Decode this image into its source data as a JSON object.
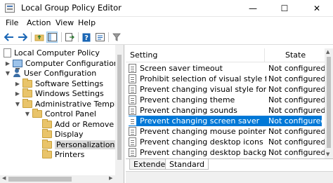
{
  "window": {
    "title": "Local Group Policy Editor"
  },
  "window_controls": {
    "minimize": "—",
    "maximize": "☐",
    "close": "✕"
  },
  "menu": [
    "File",
    "Action",
    "View",
    "Help"
  ],
  "toolbar": {
    "icons": [
      "back-arrow-icon",
      "forward-arrow-icon",
      "up-folder-icon",
      "show-hide-tree-icon",
      "export-list-icon",
      "help-icon",
      "properties-icon",
      "filter-icon"
    ],
    "accent": "#1a66b5"
  },
  "tree": {
    "items": [
      {
        "label": "Local Computer Policy",
        "icon": "policy-doc-icon",
        "arrow": ""
      },
      {
        "label": "Computer Configuration",
        "icon": "computer-icon",
        "arrow": "▶"
      },
      {
        "label": "User Configuration",
        "icon": "user-icon",
        "arrow": "▼"
      },
      {
        "label": "Software Settings",
        "icon": "folder-icon",
        "arrow": "▶"
      },
      {
        "label": "Windows Settings",
        "icon": "folder-icon",
        "arrow": "▶"
      },
      {
        "label": "Administrative Templates",
        "icon": "folder-icon",
        "arrow": "▼"
      },
      {
        "label": "Control Panel",
        "icon": "folder-icon",
        "arrow": "▼"
      },
      {
        "label": "Add or Remove Pro",
        "icon": "folder-icon",
        "arrow": ""
      },
      {
        "label": "Display",
        "icon": "folder-icon",
        "arrow": ""
      },
      {
        "label": "Personalization",
        "icon": "folder-icon",
        "arrow": ""
      },
      {
        "label": "Printers",
        "icon": "folder-icon",
        "arrow": ""
      }
    ],
    "selected": "Personalization"
  },
  "list": {
    "columns": {
      "setting": "Setting",
      "state": "State"
    },
    "rows": [
      {
        "setting": "Screen saver timeout",
        "state": "Not configured"
      },
      {
        "setting": "Prohibit selection of visual style font size",
        "state": "Not configured"
      },
      {
        "setting": "Prevent changing visual style for windo...",
        "state": "Not configured"
      },
      {
        "setting": "Prevent changing theme",
        "state": "Not configured"
      },
      {
        "setting": "Prevent changing sounds",
        "state": "Not configured"
      },
      {
        "setting": "Prevent changing screen saver",
        "state": "Not configured"
      },
      {
        "setting": "Prevent changing mouse pointers",
        "state": "Not configured"
      },
      {
        "setting": "Prevent changing desktop icons",
        "state": "Not configured"
      },
      {
        "setting": "Prevent changing desktop background",
        "state": "Not configured"
      }
    ],
    "selected_row": "Prevent changing screen saver",
    "selection_color": "#0078d7"
  },
  "tabs": {
    "extended": "Extended",
    "standard": "Standard",
    "active": "Standard"
  }
}
